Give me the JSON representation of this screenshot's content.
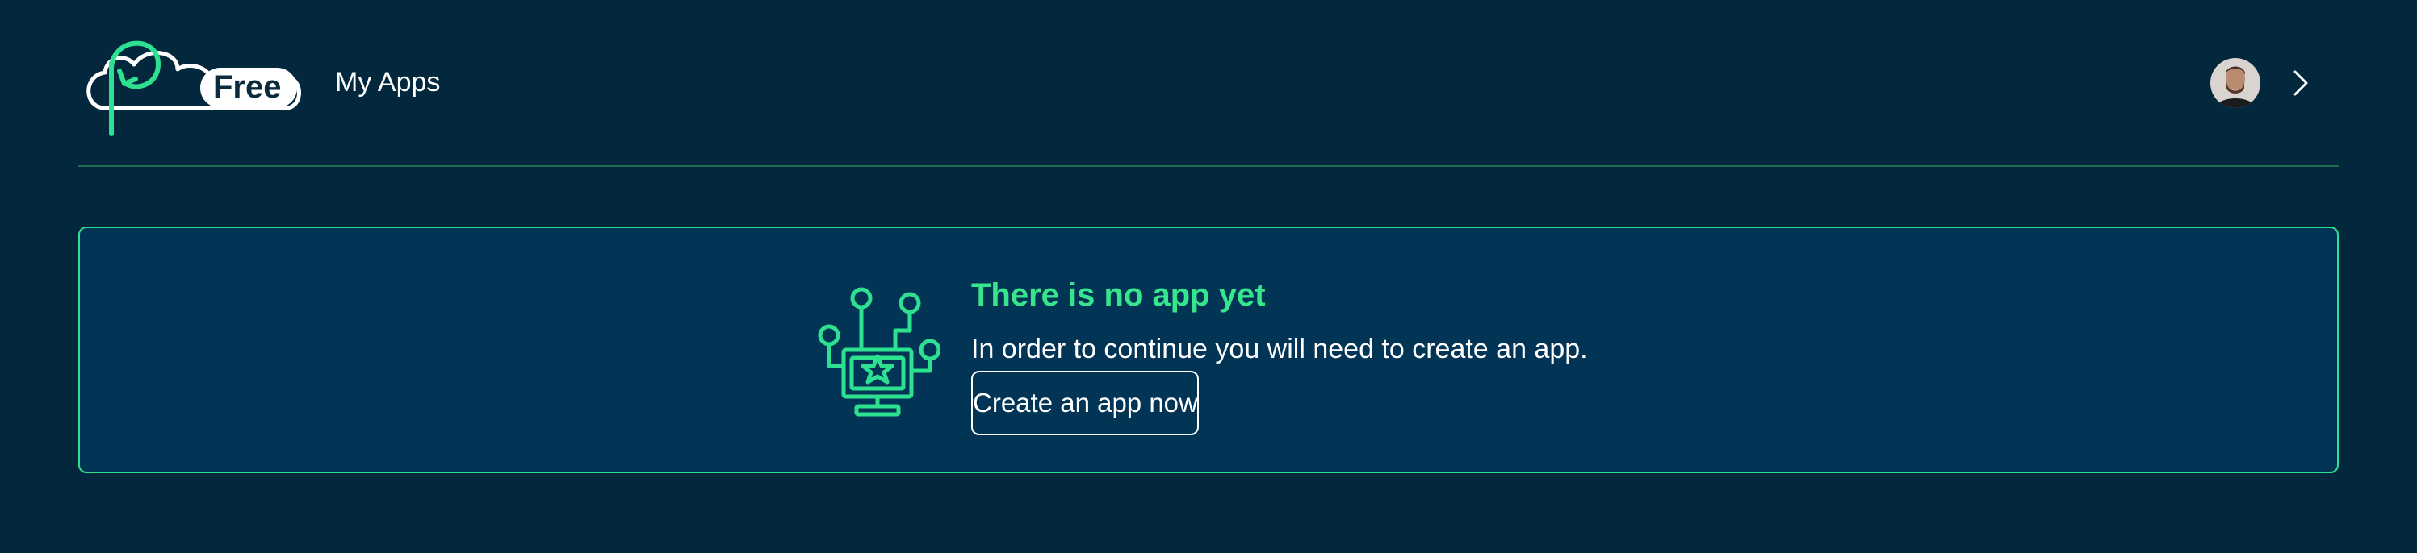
{
  "header": {
    "plan_badge": "Free",
    "nav_title": "My Apps"
  },
  "empty_state": {
    "title": "There is no app yet",
    "description": "In order to continue you will need to create an app.",
    "button_label": "Create an app now"
  },
  "colors": {
    "background": "#03273c",
    "card_background": "#023555",
    "accent": "#37e58c",
    "divider": "#1f6b4f",
    "text": "#ffffff"
  },
  "icons": {
    "logo": "cloud-logo-icon",
    "empty_state": "app-circuit-star-icon",
    "user_menu": "chevron-right-icon"
  }
}
